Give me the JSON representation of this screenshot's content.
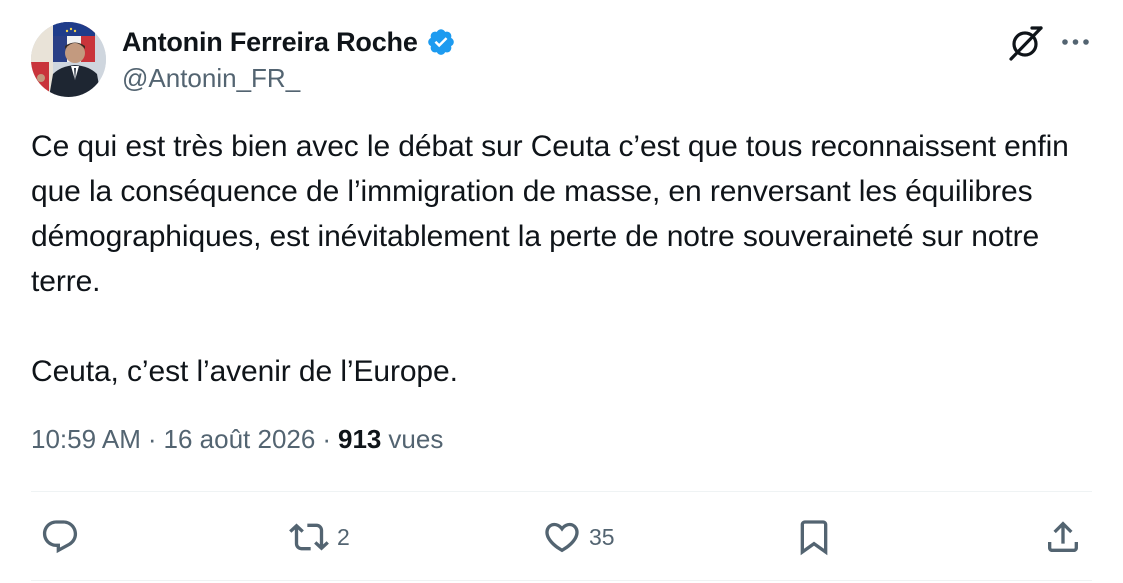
{
  "author": {
    "display_name": "Antonin Ferreira Roche",
    "handle": "@Antonin_FR_",
    "verified": true,
    "avatar_icon": "profile-photo"
  },
  "header_icons": {
    "grok": "grok-icon",
    "more": "more-options-icon"
  },
  "tweet": {
    "paragraphs": [
      "Ce qui est très bien avec le débat sur Ceuta c’est que tous reconnaissent enfin que la conséquence de l’immigration de masse, en renversant les équilibres démographiques, est inévitablement la perte de notre souveraineté sur notre terre.",
      "Ceuta, c’est l’avenir de l’Europe."
    ]
  },
  "meta": {
    "time": "10:59 AM",
    "separator": "·",
    "date": "16 août 2026",
    "views_count": "913",
    "views_label": "vues"
  },
  "actions": {
    "reply": {
      "icon": "reply-icon",
      "count": ""
    },
    "retweet": {
      "icon": "retweet-icon",
      "count": "2"
    },
    "like": {
      "icon": "heart-icon",
      "count": "35"
    },
    "bookmark": {
      "icon": "bookmark-icon",
      "count": ""
    },
    "share": {
      "icon": "share-icon",
      "count": ""
    }
  },
  "colors": {
    "text_primary": "#0f1419",
    "text_secondary": "#536471",
    "verified_blue": "#1d9bf0",
    "divider": "#eff3f4"
  }
}
